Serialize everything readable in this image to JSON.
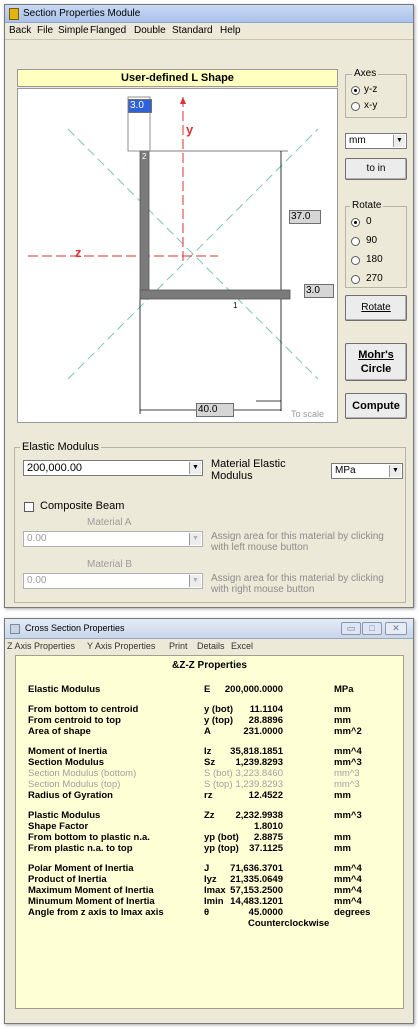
{
  "window1": {
    "title": "Section Properties Module",
    "menu": [
      "Back",
      "File",
      "Simple",
      "Flanged",
      "Double",
      "Standard",
      "Help"
    ],
    "panel_title": "User-defined L Shape",
    "drawing": {
      "axis_y_label": "y",
      "axis_z_label": "z",
      "dimensions": {
        "top_thickness": "3.0",
        "height": "37.0",
        "flange_thickness": "3.0",
        "width": "40.0"
      },
      "corner_labels": [
        "2",
        "1"
      ],
      "to_scale": "To scale"
    },
    "axes_group": {
      "label": "Axes",
      "options": [
        "y-z",
        "x-y"
      ],
      "selected": "y-z"
    },
    "units_select": "mm",
    "to_in_button": "to in",
    "rotate_group": {
      "label": "Rotate",
      "options": [
        "0",
        "90",
        "180",
        "270"
      ],
      "selected": "0"
    },
    "rotate_button": "Rotate",
    "mohr_button_line1": "Mohr's",
    "mohr_button_line2": "Circle",
    "compute_button": "Compute",
    "elastic": {
      "group_label": "Elastic Modulus",
      "value": "200,000.00",
      "material_label_line1": "Material Elastic",
      "material_label_line2": "Modulus",
      "unit": "MPa"
    },
    "composite": {
      "checkbox_label": "Composite Beam",
      "material_a_label": "Material A",
      "material_a_value": "0.00",
      "material_a_hint_line1": "Assign area for this material by clicking",
      "material_a_hint_line2": "with left mouse button",
      "material_b_label": "Material B",
      "material_b_value": "0.00",
      "material_b_hint_line1": "Assign area for this material by clicking",
      "material_b_hint_line2": "with right mouse button"
    }
  },
  "window2": {
    "title": "Cross Section Properties",
    "menu": [
      "Z Axis Properties",
      "Y Axis Properties",
      "Print",
      "Details",
      "Excel"
    ],
    "header": "&Z-Z Properties",
    "rows": [
      {
        "name": "Elastic Modulus",
        "sym": "E",
        "val": "200,000.0000",
        "unit": "MPa"
      },
      {
        "name": "From bottom to centroid",
        "sym": "y (bot)",
        "val": "11.1104",
        "unit": "mm"
      },
      {
        "name": "From centroid to top",
        "sym": "y (top)",
        "val": "28.8896",
        "unit": "mm"
      },
      {
        "name": "Area of shape",
        "sym": "A",
        "val": "231.0000",
        "unit": "mm^2"
      },
      {
        "name": "Moment of Inertia",
        "sym": "Iz",
        "val": "35,818.1851",
        "unit": "mm^4"
      },
      {
        "name": "Section Modulus",
        "sym": "Sz",
        "val": "1,239.8293",
        "unit": "mm^3"
      },
      {
        "name": "Section Modulus (bottom)",
        "sym": "S (bot)",
        "val": "3,223.8460",
        "unit": "mm^3"
      },
      {
        "name": "Section Modulus (top)",
        "sym": "S (top)",
        "val": "1,239.8293",
        "unit": "mm^3"
      },
      {
        "name": "Radius of Gyration",
        "sym": "rz",
        "val": "12.4522",
        "unit": "mm"
      },
      {
        "name": "Plastic Modulus",
        "sym": "Zz",
        "val": "2,232.9938",
        "unit": "mm^3"
      },
      {
        "name": "Shape Factor",
        "sym": "",
        "val": "1.8010",
        "unit": ""
      },
      {
        "name": "From bottom to plastic n.a.",
        "sym": "yp (bot)",
        "val": "2.8875",
        "unit": "mm"
      },
      {
        "name": "From plastic n.a. to top",
        "sym": "yp (top)",
        "val": "37.1125",
        "unit": "mm"
      },
      {
        "name": "Polar Moment of Inertia",
        "sym": "J",
        "val": "71,636.3701",
        "unit": "mm^4"
      },
      {
        "name": "Product of Inertia",
        "sym": "Iyz",
        "val": "21,335.0649",
        "unit": "mm^4"
      },
      {
        "name": "Maximum Moment of Inertia",
        "sym": "Imax",
        "val": "57,153.2500",
        "unit": "mm^4"
      },
      {
        "name": "Minumum Moment of Inertia",
        "sym": "Imin",
        "val": "14,483.1201",
        "unit": "mm^4"
      },
      {
        "name": "Angle from z axis to Imax axis",
        "sym": "θ",
        "val": "45.0000",
        "unit": "degrees"
      }
    ],
    "angle_direction": "Counterclockwise"
  }
}
